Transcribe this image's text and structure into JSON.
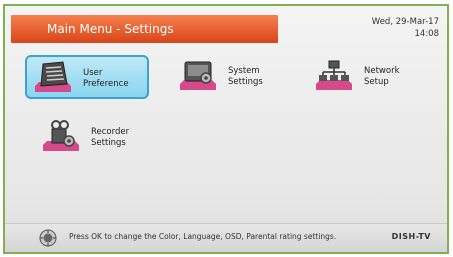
{
  "header": {
    "title": "Main Menu - Settings",
    "date": "Wed, 29-Mar-17",
    "time": "14:08"
  },
  "menu": {
    "selected_index": 0,
    "items": [
      {
        "line1": "User",
        "line2": "Preference",
        "icon": "user-preference-icon"
      },
      {
        "line1": "System",
        "line2": "Settings",
        "icon": "system-settings-icon"
      },
      {
        "line1": "Network",
        "line2": "Setup",
        "icon": "network-setup-icon"
      },
      {
        "line1": "Recorder",
        "line2": "Settings",
        "icon": "recorder-settings-icon"
      }
    ]
  },
  "footer": {
    "hint": "Press OK to change the Color, Language, OSD, Parental rating settings.",
    "brand": "DISH-TV",
    "icon": "ok-button-icon"
  },
  "colors": {
    "header_bar": "#e35a2a",
    "selected_bg": "#9bd9f0",
    "frame_border": "#7fb24e",
    "icon_base": "#d44a8a"
  }
}
